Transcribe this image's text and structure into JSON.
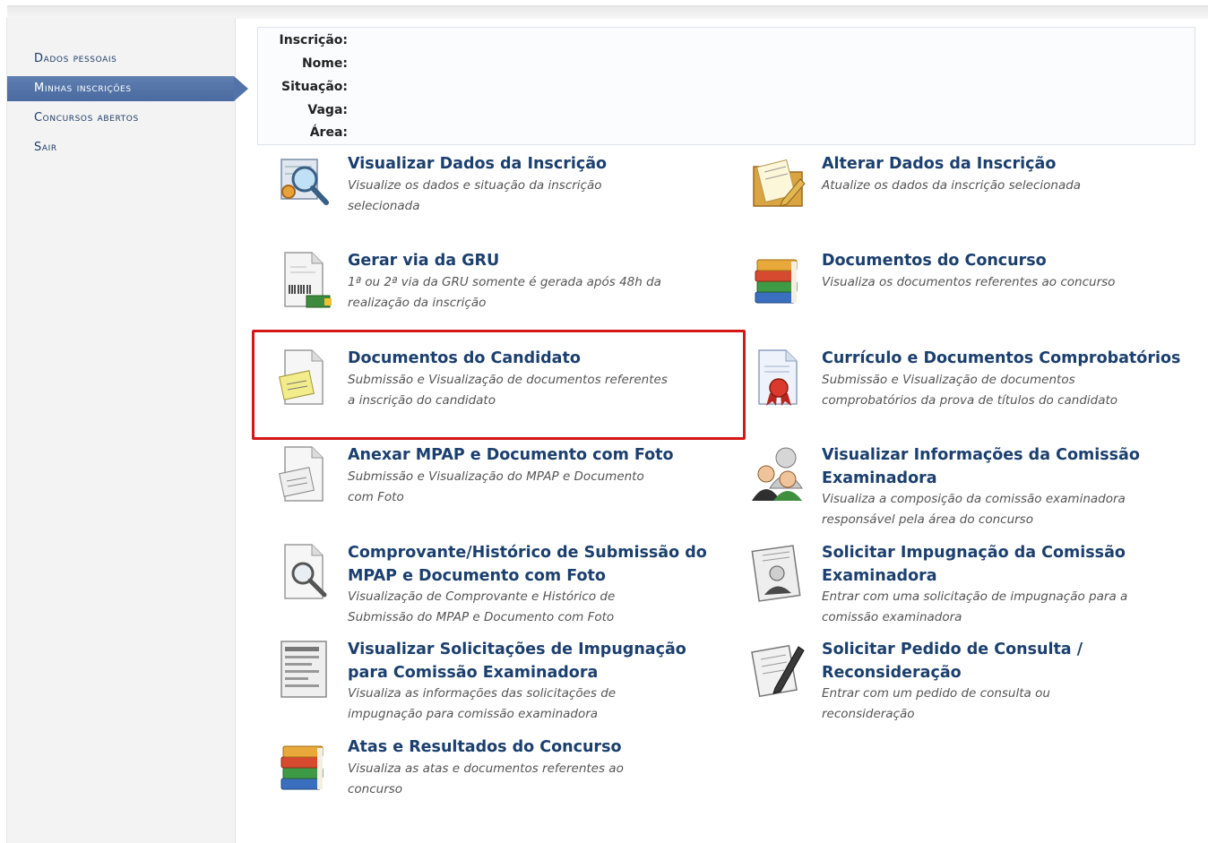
{
  "sidebar": {
    "items": [
      {
        "label": "Dados pessoais"
      },
      {
        "label": "Minhas inscrições"
      },
      {
        "label": "Concursos abertos"
      },
      {
        "label": "Sair"
      }
    ]
  },
  "info": {
    "inscricao_label": "Inscrição:",
    "nome_label": "Nome:",
    "situacao_label": "Situação:",
    "vaga_label": "Vaga:",
    "area_label": "Área:"
  },
  "actions": [
    {
      "title": "Visualizar Dados da Inscrição",
      "title2": "",
      "desc1": "Visualize os dados e situação da inscrição",
      "desc2": "selecionada",
      "icon": "magnifier-gear-icon"
    },
    {
      "title": "Alterar Dados da Inscrição",
      "title2": "",
      "desc1": "Atualize os dados da inscrição selecionada",
      "desc2": "",
      "icon": "folder-edit-icon"
    },
    {
      "title": "Gerar via da GRU",
      "title2": "",
      "desc1": "1ª ou 2ª via da GRU somente é gerada após 48h da",
      "desc2": "realização da inscrição",
      "icon": "barcode-document-icon"
    },
    {
      "title": "Documentos do Concurso",
      "title2": "",
      "desc1": "Visualiza os documentos referentes ao concurso",
      "desc2": "",
      "icon": "books-icon"
    },
    {
      "title": "Documentos do Candidato",
      "title2": "",
      "desc1": "Submissão e Visualização de documentos referentes",
      "desc2": "a inscrição do candidato",
      "icon": "document-note-icon"
    },
    {
      "title": "Currículo e Documentos Comprobatórios",
      "title2": "",
      "desc1": "Submissão e Visualização de documentos",
      "desc2": "comprobatórios da prova de títulos do candidato",
      "icon": "certificate-icon"
    },
    {
      "title": "Anexar MPAP e Documento com Foto",
      "title2": "",
      "desc1": "Submissão e Visualização do MPAP e Documento",
      "desc2": "com Foto",
      "icon": "document-attach-icon"
    },
    {
      "title": "Visualizar Informações da Comissão",
      "title2": "Examinadora",
      "desc1": "Visualiza a composição da comissão examinadora",
      "desc2": "responsável pela área do concurso",
      "icon": "users-group-icon"
    },
    {
      "title": "Comprovante/Histórico de Submissão do",
      "title2": "MPAP e Documento com Foto",
      "desc1": "Visualização de Comprovante e Histórico de",
      "desc2": "Submissão do MPAP e Documento com Foto",
      "icon": "document-search-icon"
    },
    {
      "title": "Solicitar Impugnação da Comissão",
      "title2": "Examinadora",
      "desc1": "Entrar com uma solicitação de impugnação para a",
      "desc2": "comissão examinadora",
      "icon": "id-card-icon"
    },
    {
      "title": "Visualizar Solicitações de Impugnação",
      "title2": "para Comissão Examinadora",
      "desc1": "Visualiza as informações das solicitações de",
      "desc2": "impugnação para comissão examinadora",
      "icon": "list-document-icon"
    },
    {
      "title": "Solicitar Pedido de Consulta /",
      "title2": "Reconsideração",
      "desc1": "Entrar com um pedido de consulta ou",
      "desc2": "reconsideração",
      "icon": "document-pen-icon"
    },
    {
      "title": "Atas e Resultados do Concurso",
      "title2": "",
      "desc1": "Visualiza as atas e documentos referentes ao",
      "desc2": "concurso",
      "icon": "books-icon"
    }
  ]
}
